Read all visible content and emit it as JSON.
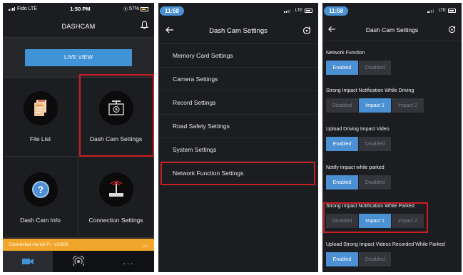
{
  "panel1": {
    "status": {
      "carrier": "Fido",
      "network": "LTE",
      "time": "1:50 PM",
      "battery": "57%"
    },
    "title": "DASHCAM",
    "live_view": "LIVE VIEW",
    "tiles": [
      "File List",
      "Dash Cam Settings",
      "Dash Cam Info",
      "Connection Settings"
    ],
    "wifi_status": "Connected via Wi-Fi - U1000",
    "tab_more": "..."
  },
  "panel2": {
    "time": "11:58",
    "network": "LTE",
    "title": "Dash Cam Settings",
    "menu": [
      "Memory Card Settings",
      "Camera Settings",
      "Record Settings",
      "Road Safety Settings",
      "System Settings",
      "Network Function Settings"
    ]
  },
  "panel3": {
    "time": "11:58",
    "network": "LTE",
    "title": "Dash Cam Settings",
    "sections": [
      {
        "title": "Network Function",
        "options": [
          "Enabled",
          "Disabled"
        ],
        "selected": 0
      },
      {
        "title": "Strong Impact Notification While Driving",
        "options": [
          "Disabled",
          "Impact 1",
          "Impact 2"
        ],
        "selected": 1
      },
      {
        "title": "Upload Driving Impact Video",
        "options": [
          "Enabled",
          "Disabled"
        ],
        "selected": 0
      },
      {
        "title": "Notify impact while parked",
        "options": [
          "Enabled",
          "Disabled"
        ],
        "selected": 0
      },
      {
        "title": "Strong Impact Notification While Parked",
        "options": [
          "Disabled",
          "Impact 1",
          "Impact 2"
        ],
        "selected": 1
      },
      {
        "title": "Upload Strong Impact Videos Recorded While Parked",
        "options": [
          "Enabled",
          "Disabled"
        ],
        "selected": 0
      }
    ]
  },
  "colors": {
    "accent": "#4a90d2",
    "highlight": "#c81e24",
    "wifi_bar": "#f2a52b",
    "background": "#1c1d20"
  }
}
